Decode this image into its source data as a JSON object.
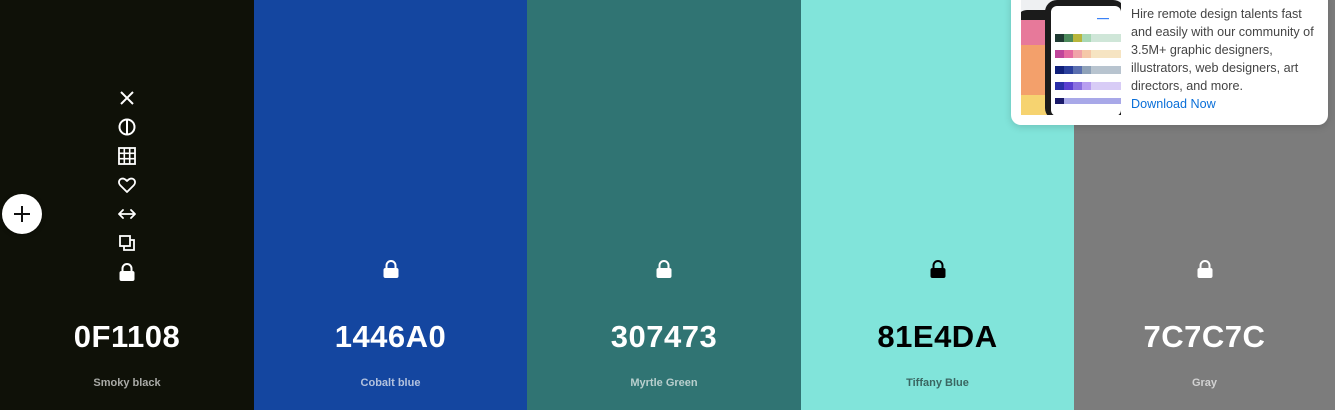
{
  "palette": {
    "colors": [
      {
        "hex": "0F1108",
        "name": "Smoky black",
        "bg": "#0F1108",
        "fg": "#ffffff",
        "name_color": "#a9aaa6"
      },
      {
        "hex": "1446A0",
        "name": "Cobalt blue",
        "bg": "#1446A0",
        "fg": "#ffffff",
        "name_color": "#b3c2de"
      },
      {
        "hex": "307473",
        "name": "Myrtle Green",
        "bg": "#307473",
        "fg": "#ffffff",
        "name_color": "#b9cfce"
      },
      {
        "hex": "81E4DA",
        "name": "Tiffany Blue",
        "bg": "#81E4DA",
        "fg": "#000000",
        "name_color": "#3a6662"
      },
      {
        "hex": "7C7C7C",
        "name": "Gray",
        "bg": "#7C7C7C",
        "fg": "#ffffff",
        "name_color": "#d2d2d2"
      }
    ],
    "tools": [
      "close-icon",
      "contrast-icon",
      "shades-grid-icon",
      "heart-icon",
      "drag-arrows-icon",
      "copy-icon",
      "lock-icon"
    ]
  },
  "ad": {
    "text": "Hire remote design talents fast and easily with our community of 3.5M+ graphic designers, illustrators, web designers, art directors, and more.",
    "cta": "Download Now"
  }
}
